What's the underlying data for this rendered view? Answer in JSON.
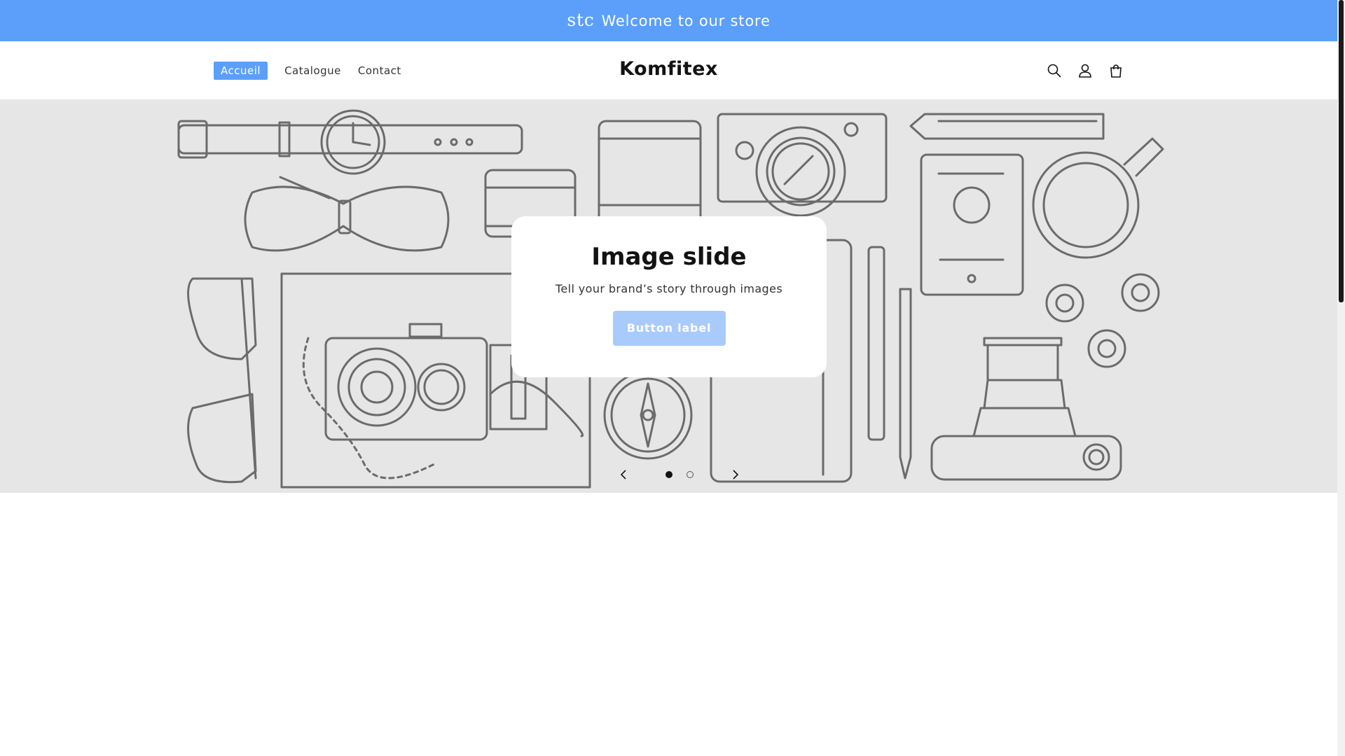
{
  "announcement": {
    "logo_text": "stc",
    "text": "Welcome to our store",
    "color": "#5b9ffb"
  },
  "header": {
    "brand": "Komfitex",
    "nav": [
      {
        "label": "Accueil",
        "active": true
      },
      {
        "label": "Catalogue",
        "active": false
      },
      {
        "label": "Contact",
        "active": false
      }
    ],
    "icons": [
      "search-icon",
      "account-icon",
      "cart-icon"
    ]
  },
  "hero": {
    "title": "Image slide",
    "text": "Tell your brand’s story through images",
    "button_label": "Button label",
    "slides_total": 2,
    "active_slide": 1,
    "controls": [
      "previous-slide-icon",
      "next-slide-icon"
    ]
  },
  "colors": {
    "accent": "#5b9ffb",
    "button": "#a9cbfc",
    "hero_bg": "#e6e6e6"
  }
}
